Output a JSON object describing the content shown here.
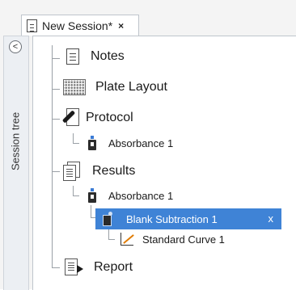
{
  "tab": {
    "title": "New Session*",
    "close": "×"
  },
  "rail": {
    "label": "Session tree",
    "toggle": "<"
  },
  "tree": {
    "notes": "Notes",
    "plate_layout": "Plate Layout",
    "protocol": "Protocol",
    "protocol_absorbance": "Absorbance 1",
    "results": "Results",
    "results_absorbance": "Absorbance 1",
    "blank_subtraction": "Blank Subtraction 1",
    "blank_close": "x",
    "standard_curve": "Standard Curve 1",
    "report": "Report"
  },
  "colors": {
    "selection": "#3f83d6",
    "accent_blue": "#3a7bd5",
    "curve": "#e07b00"
  }
}
